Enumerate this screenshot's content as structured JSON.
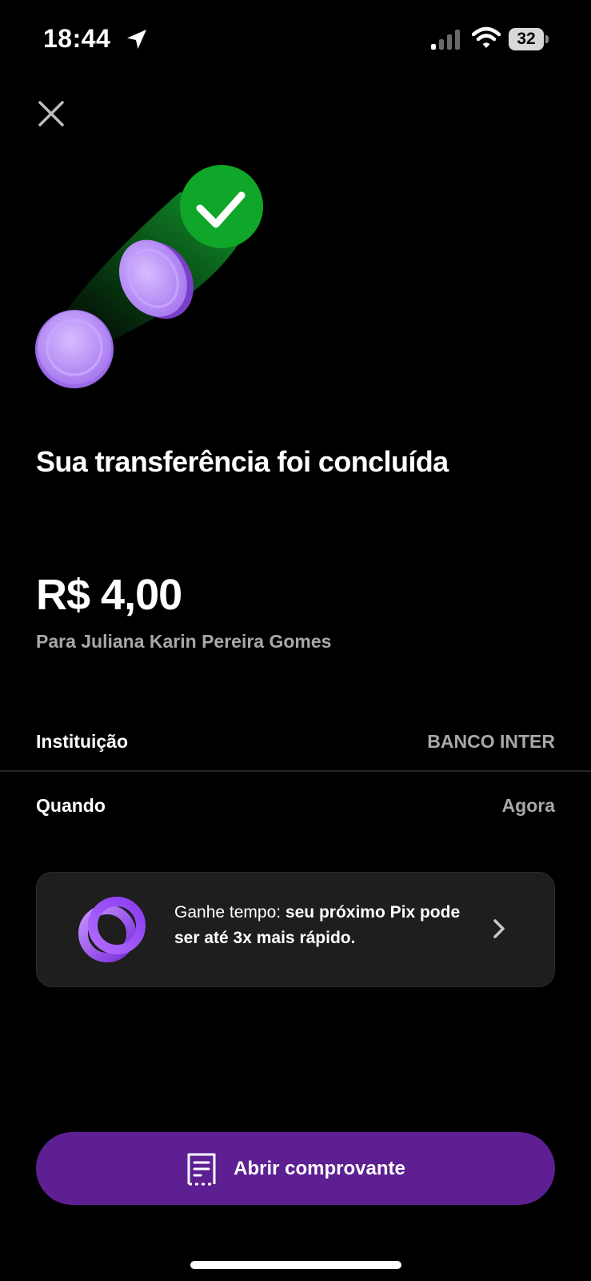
{
  "status_bar": {
    "time": "18:44",
    "battery": "32"
  },
  "icons": {
    "close": "close-icon",
    "location": "location-arrow-icon",
    "signal": "cellular-signal-icon",
    "wifi": "wifi-icon",
    "success": "check-circle-icon",
    "coins": "coin-icon",
    "promo_logo": "pix-ring-icon",
    "chevron": "chevron-right-icon",
    "receipt": "receipt-icon"
  },
  "colors": {
    "background": "#000000",
    "success_green": "#10a629",
    "coin_purple": "#b98cf5",
    "primary_purple": "#5e1f93",
    "muted_text": "#a8a8a8"
  },
  "header": {
    "title": "Sua transferência foi concluída"
  },
  "transfer": {
    "amount": "R$ 4,00",
    "recipient": "Para Juliana Karin Pereira Gomes"
  },
  "details": [
    {
      "label": "Instituição",
      "value": "BANCO INTER"
    },
    {
      "label": "Quando",
      "value": "Agora"
    }
  ],
  "promo": {
    "text_regular": "Ganhe tempo: ",
    "text_bold": "seu próximo Pix pode ser até 3x mais rápido."
  },
  "actions": {
    "open_receipt": "Abrir comprovante"
  }
}
